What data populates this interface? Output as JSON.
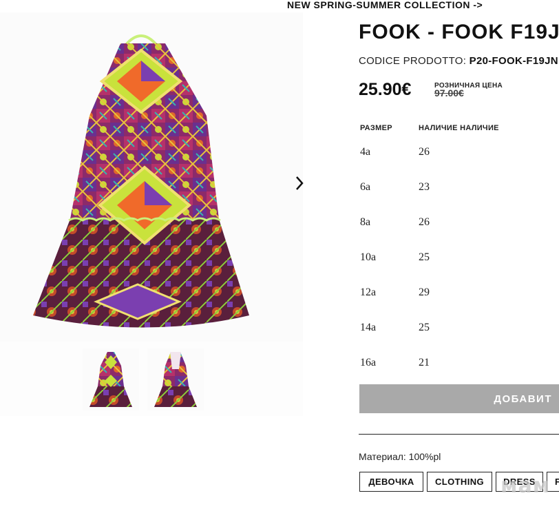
{
  "header": {
    "collection_link": "NEW SPRING-SUMMER COLLECTION ->"
  },
  "gallery": {
    "next_icon": "chevron-right-icon",
    "thumbnails": [
      "front-view",
      "back-view"
    ]
  },
  "product": {
    "title": "FOOK - FOOK F19J",
    "code_label": "CODICE PRODOTTO:",
    "code_value": "P20-FOOK-F19JN",
    "price": "25.90€",
    "retail_label": "РОЗНИЧНАЯ ЦЕНА",
    "retail_price": "97.00€"
  },
  "sizes_table": {
    "headers": {
      "size": "РАЗМЕР",
      "availability": "НАЛИЧИЕ НАЛИЧИЕ"
    },
    "rows": [
      {
        "size": "4a",
        "qty": "26"
      },
      {
        "size": "6a",
        "qty": "23"
      },
      {
        "size": "8a",
        "qty": "26"
      },
      {
        "size": "10a",
        "qty": "25"
      },
      {
        "size": "12a",
        "qty": "29"
      },
      {
        "size": "14a",
        "qty": "25"
      },
      {
        "size": "16a",
        "qty": "21"
      }
    ]
  },
  "cart": {
    "add_label": "ДОБАВИТ"
  },
  "material": "Материал: 100%pl",
  "tags": [
    "ДЕВОЧКА",
    "CLOTHING",
    "DRESS",
    "F"
  ],
  "watermark": "мам",
  "colors": {
    "button_bg": "#a9a9a9",
    "text": "#111111",
    "dress_magenta": "#a8236e",
    "dress_lime": "#c9e23c",
    "dress_orange": "#f06a2a",
    "dress_purple": "#7b3fb0"
  }
}
